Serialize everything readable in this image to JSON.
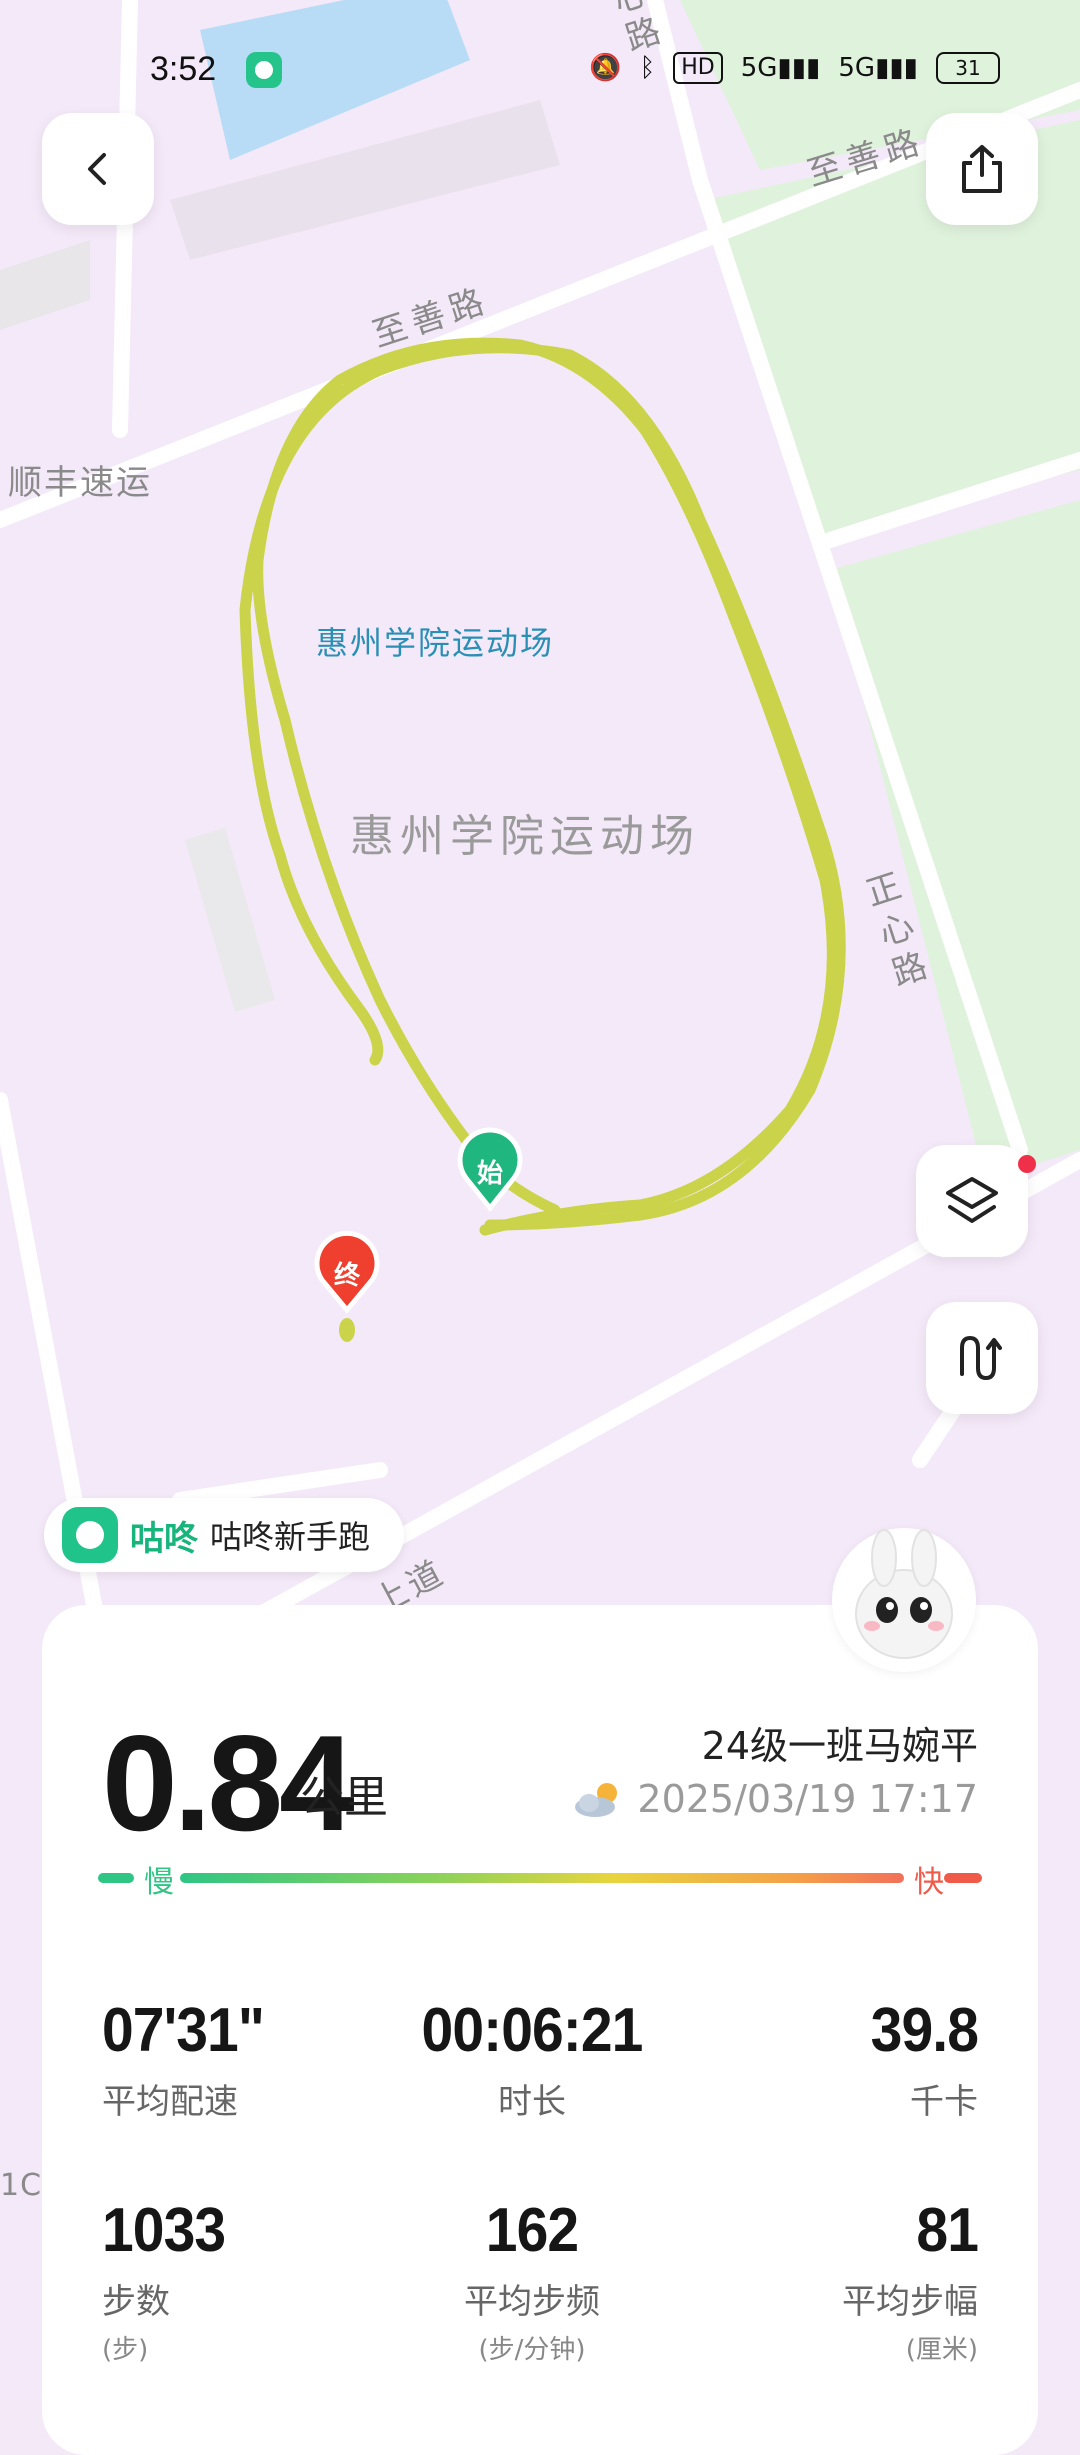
{
  "status_bar": {
    "time": "3:52",
    "hd_badge": "HD",
    "net1": "5G",
    "net2": "5G",
    "battery": "31"
  },
  "map": {
    "labels": {
      "road_top_right": "至善路",
      "road_top_left": "至善路",
      "poi_left": "顺丰速运",
      "venue_highlight": "惠州学院运动场",
      "venue_area": "惠州学院运动场",
      "road_right": "正心路",
      "road_top_partial": "心路",
      "road_bottom_partial": "上道",
      "edge_left": "1C"
    },
    "markers": {
      "start": "始",
      "end": "终"
    },
    "colors": {
      "track": "#cbd34a",
      "start": "#1fb67f",
      "end": "#ef3f2f",
      "venue_label": "#2a8fb5"
    }
  },
  "app_tag": {
    "brand": "咕咚",
    "mode": "咕咚新手跑"
  },
  "summary": {
    "distance": "0.84",
    "distance_unit": "公里",
    "user_name": "24级一班马婉平",
    "datetime": "2025/03/19 17:17",
    "weather_icon": "partly-cloudy-icon",
    "pace_slow": "慢",
    "pace_fast": "快"
  },
  "stats": [
    {
      "value": "07'31\"",
      "label": "平均配速",
      "unit": ""
    },
    {
      "value": "00:06:21",
      "label": "时长",
      "unit": ""
    },
    {
      "value": "39.8",
      "label": "千卡",
      "unit": ""
    },
    {
      "value": "1033",
      "label": "步数",
      "unit": "(步)"
    },
    {
      "value": "162",
      "label": "平均步频",
      "unit": "(步/分钟)"
    },
    {
      "value": "81",
      "label": "平均步幅",
      "unit": "(厘米)"
    }
  ]
}
